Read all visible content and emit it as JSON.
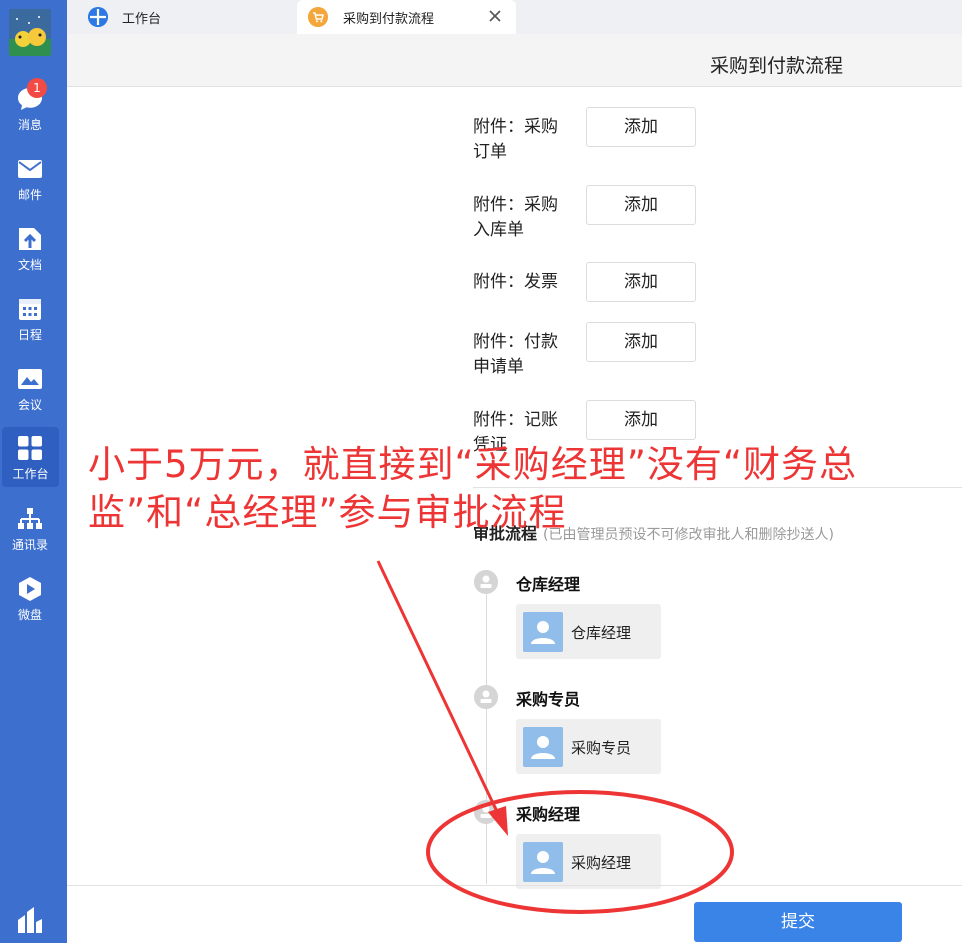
{
  "sidebar": {
    "items": [
      {
        "label": "消息",
        "icon": "chat-bubble-icon",
        "badge": "1"
      },
      {
        "label": "邮件",
        "icon": "mail-icon"
      },
      {
        "label": "文档",
        "icon": "document-icon"
      },
      {
        "label": "日程",
        "icon": "calendar-icon"
      },
      {
        "label": "会议",
        "icon": "meeting-icon"
      },
      {
        "label": "工作台",
        "icon": "workbench-grid-icon",
        "active": true
      },
      {
        "label": "通讯录",
        "icon": "contacts-org-icon"
      },
      {
        "label": "微盘",
        "icon": "cloud-drive-icon"
      }
    ],
    "bottom_icon": "app-logo-icon"
  },
  "tabs": [
    {
      "label": "工作台",
      "icon": "workbench-globe-icon"
    },
    {
      "label": "采购到付款流程",
      "icon": "shopping-cart-icon",
      "active": true,
      "closable": true
    }
  ],
  "page": {
    "title": "采购到付款流程"
  },
  "attachments": [
    {
      "label": "附件：采购订单",
      "button": "添加"
    },
    {
      "label": "附件：采购入库单",
      "button": "添加"
    },
    {
      "label": "附件：发票",
      "button": "添加"
    },
    {
      "label": "附件：付款申请单",
      "button": "添加"
    },
    {
      "label": "附件：记账凭证",
      "button": "添加"
    }
  ],
  "flow": {
    "heading": "审批流程",
    "note": "(已由管理员预设不可修改审批人和删除抄送人)",
    "steps": [
      {
        "title": "仓库经理",
        "person": "仓库经理"
      },
      {
        "title": "采购专员",
        "person": "采购专员"
      },
      {
        "title": "采购经理",
        "person": "采购经理"
      }
    ]
  },
  "footer": {
    "submit_label": "提交"
  },
  "annotation": {
    "text": "小于5万元，就直接到“采购经理”没有“财务总监”和“总经理”参与审批流程",
    "color": "#ee3535"
  },
  "colors": {
    "sidebar": "#3d6fcf",
    "primary_button": "#3a84e8",
    "badge": "#f24a45"
  }
}
